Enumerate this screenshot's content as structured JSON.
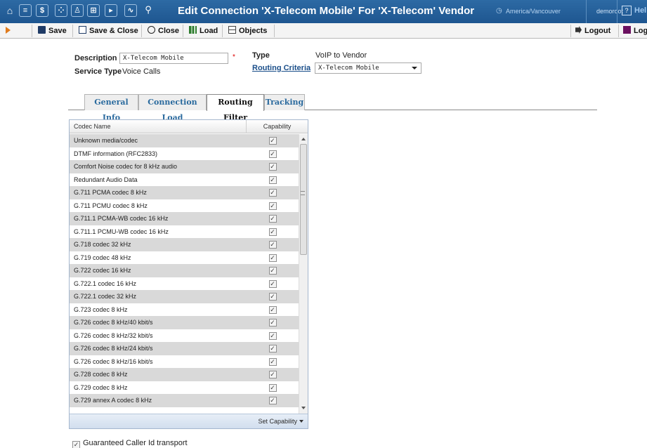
{
  "header": {
    "title": "Edit Connection 'X-Telecom Mobile' For 'X-Telecom' Vendor",
    "timezone": "America/Vancouver",
    "user": "demoroot",
    "help_label": "Hel",
    "nav_icons": [
      "home-icon",
      "list-icon",
      "dollar-icon",
      "grid-icon",
      "person-icon",
      "tree-icon",
      "play-icon",
      "chart-icon",
      "search-icon"
    ]
  },
  "toolbar": {
    "save_label": "Save",
    "save_close_label": "Save & Close",
    "close_label": "Close",
    "load_label": "Load",
    "objects_label": "Objects",
    "logout_label": "Logout",
    "log_label": "Log"
  },
  "form": {
    "description_label": "Description",
    "description_value": "X-Telecom Mobile",
    "required_mark": "*",
    "service_type_label": "Service Type",
    "service_type_value": "Voice Calls",
    "type_label": "Type",
    "type_value": "VoIP to Vendor",
    "routing_criteria_label": "Routing Criteria",
    "routing_criteria_value": "X-Telecom Mobile"
  },
  "tabs": [
    {
      "label": "General Info",
      "active": false
    },
    {
      "label": "Connection Load",
      "active": false
    },
    {
      "label": "Routing Filter",
      "active": true
    },
    {
      "label": "Tracking",
      "active": false
    }
  ],
  "grid": {
    "col_codec": "Codec Name",
    "col_capability": "Capability",
    "check_glyph": "✓",
    "rows": [
      {
        "name": "Unknown media/codec",
        "checked": true
      },
      {
        "name": "DTMF information (RFC2833)",
        "checked": true
      },
      {
        "name": "Comfort Noise codec for 8 kHz audio",
        "checked": true
      },
      {
        "name": "Redundant Audio Data",
        "checked": true
      },
      {
        "name": "G.711 PCMA codec 8 kHz",
        "checked": true
      },
      {
        "name": "G.711 PCMU codec 8 kHz",
        "checked": true
      },
      {
        "name": "G.711.1 PCMA-WB codec 16 kHz",
        "checked": true
      },
      {
        "name": "G.711.1 PCMU-WB codec 16 kHz",
        "checked": true
      },
      {
        "name": "G.718 codec 32 kHz",
        "checked": true
      },
      {
        "name": "G.719 codec 48 kHz",
        "checked": true
      },
      {
        "name": "G.722 codec 16 kHz",
        "checked": true
      },
      {
        "name": "G.722.1 codec 16 kHz",
        "checked": true
      },
      {
        "name": "G.722.1 codec 32 kHz",
        "checked": true
      },
      {
        "name": "G.723 codec 8 kHz",
        "checked": true
      },
      {
        "name": "G.726 codec 8 kHz/40 kbit/s",
        "checked": true
      },
      {
        "name": "G.726 codec 8 kHz/32 kbit/s",
        "checked": true
      },
      {
        "name": "G.726 codec 8 kHz/24 kbit/s",
        "checked": true
      },
      {
        "name": "G.726 codec 8 kHz/16 kbit/s",
        "checked": true
      },
      {
        "name": "G.728 codec 8 kHz",
        "checked": true
      },
      {
        "name": "G.729 codec 8 kHz",
        "checked": true
      },
      {
        "name": "G.729 annex A codec 8 kHz",
        "checked": true
      }
    ],
    "footer_button": "Set Capability"
  },
  "options": {
    "guaranteed_caller_id_label": "Guaranteed Caller Id transport",
    "guaranteed_caller_id_checked": true
  },
  "colors": {
    "header_bg": "#1e5690",
    "tab_text": "#2a6a9e",
    "row_alt": "#d9d9d9",
    "toolbar_arrow": "#e07b1d"
  }
}
